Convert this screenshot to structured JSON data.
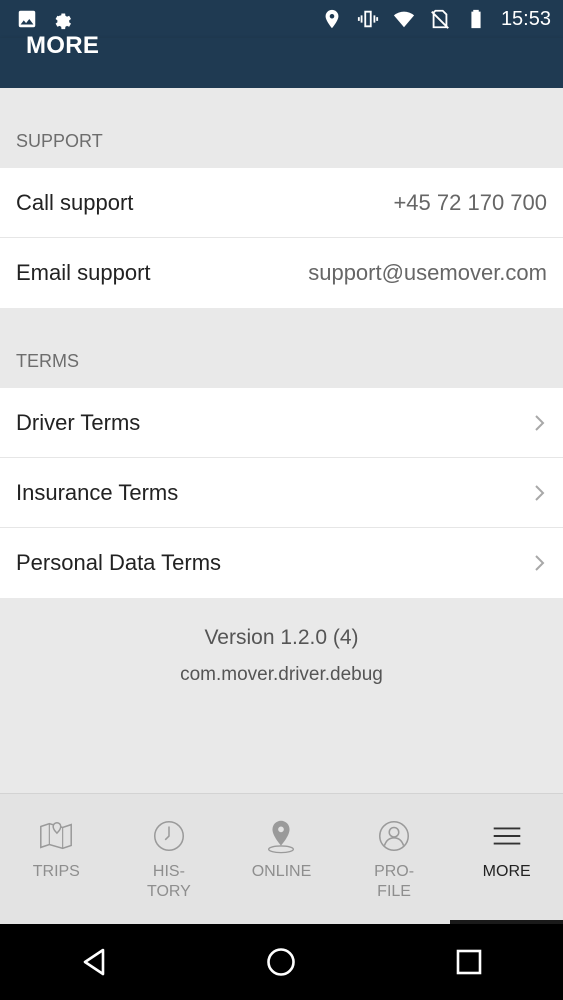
{
  "status_bar": {
    "time": "15:53",
    "icons_left": [
      "image-icon",
      "settings-gear-icon"
    ],
    "icons_right": [
      "location-icon",
      "vibrate-icon",
      "wifi-icon",
      "no-sim-icon",
      "battery-icon"
    ]
  },
  "app_bar": {
    "title": "MORE"
  },
  "support": {
    "header": "SUPPORT",
    "call_label": "Call support",
    "call_value": "+45 72 170 700",
    "email_label": "Email support",
    "email_value": "support@usemover.com"
  },
  "terms": {
    "header": "TERMS",
    "items": [
      {
        "label": "Driver Terms"
      },
      {
        "label": "Insurance Terms"
      },
      {
        "label": "Personal Data Terms"
      }
    ]
  },
  "footer": {
    "version": "Version 1.2.0 (4)",
    "package": "com.mover.driver.debug"
  },
  "tabs": [
    {
      "label": "TRIPS",
      "icon": "map-icon",
      "active": false
    },
    {
      "label": "HIS-\nTORY",
      "icon": "clock-icon",
      "active": false
    },
    {
      "label": "ONLINE",
      "icon": "location-pin-icon",
      "active": false
    },
    {
      "label": "PRO-\nFILE",
      "icon": "profile-icon",
      "active": false
    },
    {
      "label": "MORE",
      "icon": "menu-icon",
      "active": true
    }
  ],
  "colors": {
    "header_bg": "#1f3a52",
    "page_bg": "#e9e9e9",
    "tab_bg": "#e3e3e3",
    "active_tab_indicator": "#1a1a1a"
  }
}
